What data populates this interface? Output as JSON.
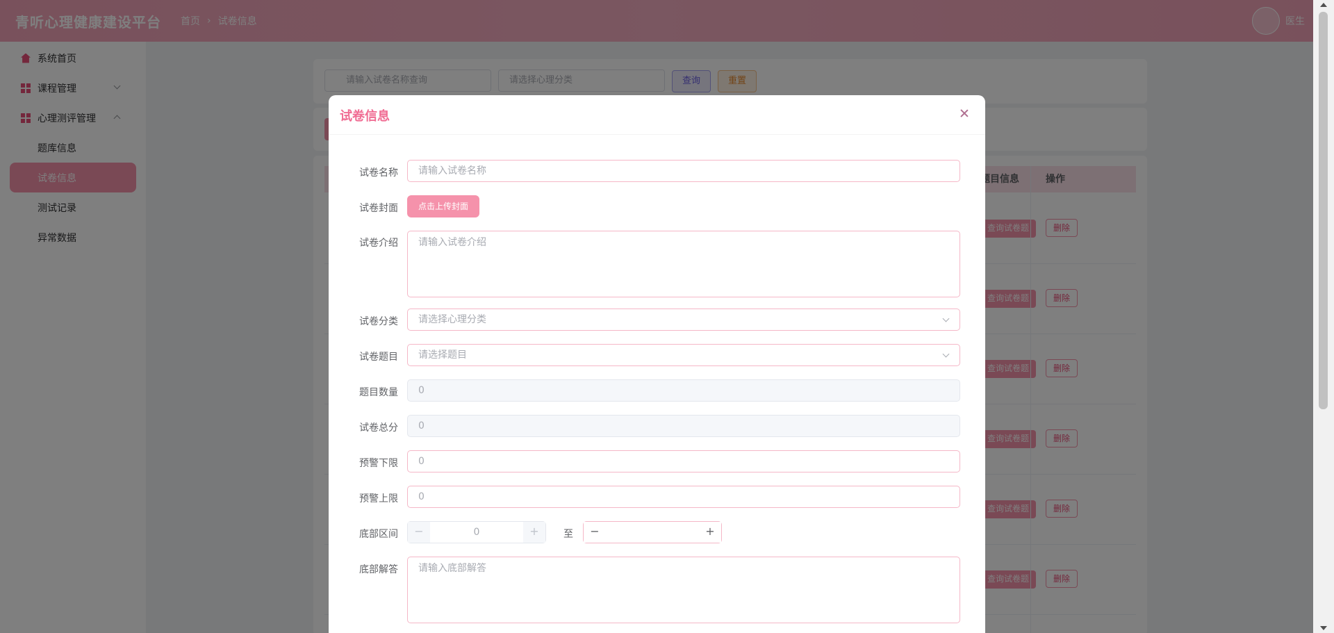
{
  "header": {
    "brand": "青听心理健康建设平台",
    "breadcrumb": [
      "首页",
      "试卷信息"
    ],
    "breadcrumb_sep": "›",
    "user_name": "医生"
  },
  "sidebar": {
    "items": [
      {
        "label": "系统首页",
        "icon": "home-icon"
      },
      {
        "label": "课程管理",
        "icon": "grid-icon",
        "expanded": false
      },
      {
        "label": "心理测评管理",
        "icon": "grid-icon",
        "expanded": true
      }
    ],
    "sub_items": [
      {
        "label": "题库信息",
        "active": false
      },
      {
        "label": "试卷信息",
        "active": true
      },
      {
        "label": "测试记录",
        "active": false
      },
      {
        "label": "异常数据",
        "active": false
      }
    ]
  },
  "search": {
    "name_placeholder": "请输入试卷名称查询",
    "category_placeholder": "请选择心理分类",
    "query_label": "查询",
    "reset_label": "重置"
  },
  "table": {
    "headers": [
      "题目信息",
      "操作"
    ],
    "rows": [
      {
        "query_label": "查询试卷题",
        "delete_label": "删除"
      },
      {
        "query_label": "查询试卷题",
        "delete_label": "删除"
      },
      {
        "query_label": "查询试卷题",
        "delete_label": "删除"
      },
      {
        "query_label": "查询试卷题",
        "delete_label": "删除"
      },
      {
        "query_label": "查询试卷题",
        "delete_label": "删除"
      },
      {
        "query_label": "查询试卷题",
        "delete_label": "删除"
      }
    ]
  },
  "dialog": {
    "title": "试卷信息",
    "fields": {
      "name": {
        "label": "试卷名称",
        "placeholder": "请输入试卷名称"
      },
      "cover": {
        "label": "试卷封面",
        "button": "点击上传封面"
      },
      "intro": {
        "label": "试卷介绍",
        "placeholder": "请输入试卷介绍"
      },
      "category": {
        "label": "试卷分类",
        "placeholder": "请选择心理分类"
      },
      "questions": {
        "label": "试卷题目",
        "placeholder": "请选择题目"
      },
      "count": {
        "label": "题目数量",
        "value": "0"
      },
      "total": {
        "label": "试卷总分",
        "value": "0"
      },
      "warn_low": {
        "label": "预警下限",
        "value": "0"
      },
      "warn_high": {
        "label": "预警上限",
        "value": "0"
      },
      "range": {
        "label": "底部区间",
        "from": "0",
        "to_label": "至",
        "to": "",
        "minus": "−",
        "plus": "+"
      },
      "answer": {
        "label": "底部解答",
        "placeholder": "请输入底部解答"
      }
    }
  },
  "colors": {
    "brand_pink": "#f592ab",
    "title_pink": "#f06c93",
    "icon_pink": "#e94e78"
  }
}
